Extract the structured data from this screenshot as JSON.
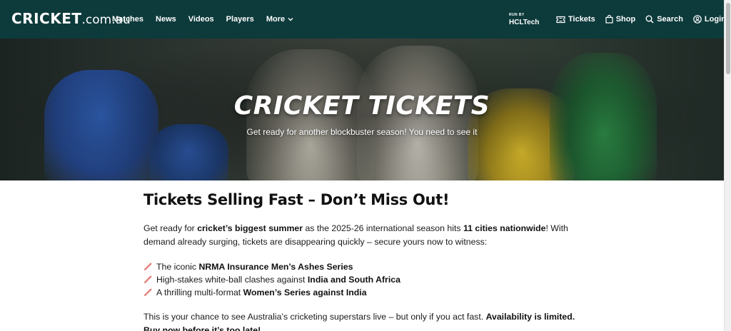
{
  "header": {
    "logo_brand": "CRICKET",
    "logo_domain": ".com.au",
    "nav": [
      "Matches",
      "News",
      "Videos",
      "Players",
      "More"
    ],
    "run_by": "RUN BY",
    "sponsor": "HCLTech",
    "utils": [
      "Tickets",
      "Shop",
      "Search",
      "Login"
    ]
  },
  "hero": {
    "title": "CRICKET TICKETS",
    "subtitle": "Get ready for another blockbuster season! You need to see it"
  },
  "article": {
    "heading": "Tickets Selling Fast – Don’t Miss Out!",
    "p1": {
      "a": "Get ready for ",
      "b": "cricket’s biggest summer",
      "c": " as the 2025-26 international season hits ",
      "d": "11 cities nationwide",
      "e": "! With demand already surging, tickets are disappearing quickly – secure yours now to witness:"
    },
    "list": [
      {
        "pre": "The iconic ",
        "bold": "NRMA Insurance Men’s Ashes Series"
      },
      {
        "pre": "High-stakes white-ball clashes against ",
        "bold": "India and South Africa"
      },
      {
        "pre": "A thrilling multi-format ",
        "bold": "Women’s Series against India"
      }
    ],
    "p2": {
      "a": "This is your chance to see Australia’s cricketing superstars live – but only if you act fast. ",
      "b": "Availability is limited. Buy now before it’s too late!"
    }
  },
  "colors": {
    "header_bg": "#0d3a3b",
    "list_icon": "#d9534f"
  }
}
